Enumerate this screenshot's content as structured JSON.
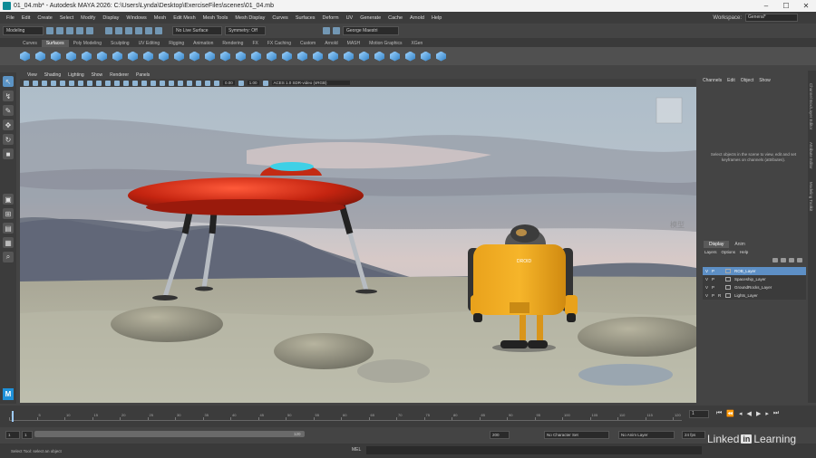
{
  "titlebar": {
    "title": "01_04.mb* - Autodesk MAYA 2026: C:\\Users\\Lynda\\Desktop\\ExerciseFiles\\scenes\\01_04.mb",
    "minimize": "–",
    "maximize": "☐",
    "close": "✕"
  },
  "menubar": {
    "items": [
      "File",
      "Edit",
      "Create",
      "Select",
      "Modify",
      "Display",
      "Windows",
      "Mesh",
      "Edit Mesh",
      "Mesh Tools",
      "Mesh Display",
      "Curves",
      "Surfaces",
      "Deform",
      "UV",
      "Generate",
      "Cache",
      "Arnold",
      "Help"
    ],
    "workspace_label": "Workspace:",
    "workspace_value": "General*"
  },
  "statusline": {
    "menuset": "Modeling",
    "live_surface": "No Live Surface",
    "symmetry": "Symmetry: Off",
    "user": "George Maestri"
  },
  "shelf": {
    "tabs": [
      "Curves",
      "Surfaces",
      "Poly Modeling",
      "Sculpting",
      "UV Editing",
      "Rigging",
      "Animation",
      "Rendering",
      "FX",
      "FX Caching",
      "Custom",
      "Arnold",
      "MASH",
      "Motion Graphics",
      "XGen"
    ],
    "active_tab": "Surfaces"
  },
  "panel": {
    "menus": [
      "View",
      "Shading",
      "Lighting",
      "Show",
      "Renderer",
      "Panels"
    ],
    "field_a": "0.00",
    "field_b": "1.00",
    "colorspace": "ACES 1.0 SDR-video (sRGB)"
  },
  "channelbox": {
    "menus": [
      "Channels",
      "Edit",
      "Object",
      "Show"
    ],
    "hint": "Select objects in the scene to view, edit and set keyframes on channels (attributes)."
  },
  "layers": {
    "tabs": [
      "Display",
      "Anim"
    ],
    "menus": [
      "Layers",
      "Options",
      "Help"
    ],
    "items": [
      {
        "v": "V",
        "p": "P",
        "r": "",
        "name": "ROB_Layer",
        "selected": true
      },
      {
        "v": "V",
        "p": "P",
        "r": "",
        "name": "Spaceship_Layer",
        "selected": false
      },
      {
        "v": "V",
        "p": "P",
        "r": "",
        "name": "GroundRocks_Layer",
        "selected": false
      },
      {
        "v": "V",
        "p": "P",
        "r": "R",
        "name": "Lights_Layer",
        "selected": false
      }
    ]
  },
  "sidetabs": [
    "Channel Box/Layer Editor",
    "Attribute Editor",
    "Modeling Toolkit"
  ],
  "timeslider": {
    "ticks": [
      "1",
      "5",
      "10",
      "15",
      "20",
      "25",
      "30",
      "35",
      "40",
      "45",
      "50",
      "55",
      "60",
      "65",
      "70",
      "75",
      "80",
      "85",
      "90",
      "95",
      "100",
      "105",
      "110",
      "115",
      "120"
    ],
    "current_frame": "1"
  },
  "rangeslider": {
    "start": "1",
    "range_start": "1",
    "range_end": "120",
    "end": "200",
    "character_set": "No Character Set",
    "anim_layer": "No Anim Layer",
    "fps": "24 fps"
  },
  "commandline": {
    "help": "Select Tool: select an object",
    "mel": "MEL"
  },
  "watermark": {
    "text": "Linked",
    "in": "in",
    "suffix": "Learning"
  },
  "robot_label": "DROID"
}
